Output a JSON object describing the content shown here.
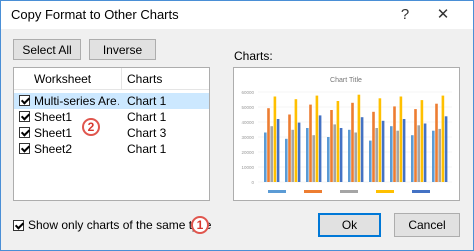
{
  "window": {
    "title": "Copy Format to Other Charts"
  },
  "titlebar": {
    "help_label": "?",
    "close_label": "✕"
  },
  "toolbar": {
    "select_all_label": "Select All",
    "inverse_label": "Inverse"
  },
  "list": {
    "headers": [
      "Worksheet",
      "Charts"
    ],
    "rows": [
      {
        "worksheet": "Multi-series Are…",
        "chart": "Chart 1",
        "checked": true,
        "selected": true
      },
      {
        "worksheet": "Sheet1",
        "chart": "Chart 1",
        "checked": true,
        "selected": false
      },
      {
        "worksheet": "Sheet1",
        "chart": "Chart 3",
        "checked": true,
        "selected": false
      },
      {
        "worksheet": "Sheet2",
        "chart": "Chart 1",
        "checked": true,
        "selected": false
      }
    ],
    "annotation": "2"
  },
  "preview": {
    "label": "Charts:",
    "chart_title": "Chart Title",
    "y_ticks": [
      "60000",
      "50000",
      "40000",
      "30000",
      "20000",
      "10000",
      "0"
    ]
  },
  "footer": {
    "same_type_label": "Show only charts of the same type",
    "same_type_checked": true,
    "annotation": "1",
    "ok_label": "Ok",
    "cancel_label": "Cancel"
  },
  "colors": {
    "accent": "#0078d7",
    "selection": "#cce8ff",
    "badge": "#e0564e",
    "series": [
      "#5b9bd5",
      "#ed7d31",
      "#a5a5a5",
      "#ffc000",
      "#4472c4"
    ]
  }
}
